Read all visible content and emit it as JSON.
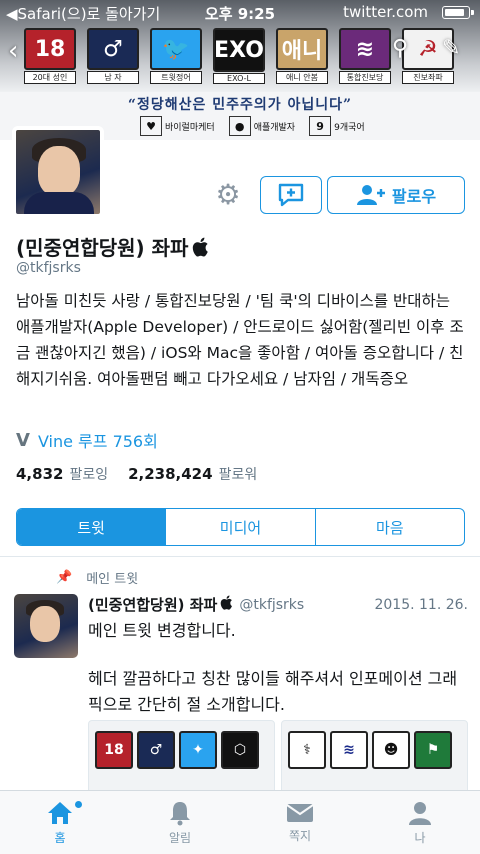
{
  "status_bar": {
    "back_app": "◀Safari(으)로 돌아가기",
    "time": "오후 9:25",
    "domain": "twitter.com",
    "battery_percent": 90
  },
  "banner": {
    "tiles": [
      {
        "label": "18",
        "caption": "20대 성인",
        "color": "#b5222b"
      },
      {
        "label": "♂",
        "caption": "남 자",
        "color": "#1a2a55"
      },
      {
        "label": "🐦",
        "caption": "트윗정어",
        "color": "#2aa3ef"
      },
      {
        "label": "EXO",
        "caption": "EXO-L",
        "color": "#111111"
      },
      {
        "label": "애니",
        "caption": "애니 안봄",
        "color": "#c9a46a"
      },
      {
        "label": "≋",
        "caption": "통합진보당",
        "color": "#6b2a7a"
      },
      {
        "label": "☭",
        "caption": "진보좌파",
        "color": "#f2f2f2"
      }
    ],
    "slogan": "“정당해산은 민주주의가 아닙니다”",
    "badges": [
      {
        "icon": "♥",
        "text": "바이럴마케터"
      },
      {
        "icon": "",
        "text": "애플개발자"
      },
      {
        "icon": "9",
        "text": "9개국어"
      }
    ]
  },
  "profile": {
    "name": "(민중연합당원) 좌파",
    "handle": "@tkfjsrks",
    "bio": "남아돌 미친듯 사랑 / 통합진보당원 / '팀 쿡'의 디바이스를 반대하는 애플개발자(Apple Developer) / 안드로이드 싫어함(젤리빈 이후 조금 괜찮아지긴 했음) / iOS와 Mac을 좋아함 / 여아돌 증오합니다 / 친해지기쉬움. 여아돌팬덤 빼고 다가오세요 / 남자임 / 개독증오",
    "vine_label": "Vine 루프 756회",
    "following_count": "4,832",
    "following_label": "팔로잉",
    "followers_count": "2,238,424",
    "followers_label": "팔로워",
    "follow_button": "팔로우"
  },
  "tabs": [
    "트윗",
    "미디어",
    "마음"
  ],
  "pinned_label": "메인 트윗",
  "tweet": {
    "name": "(민중연합당원) 좌파",
    "handle": "@tkfjsrks",
    "date": "2015. 11. 26.",
    "line1": "메인 트윗 변경합니다.",
    "line2": "헤더 깔끔하다고 칭찬 많이들 해주셔서 인포메이션 그래픽으로 간단히 절 소개합니다."
  },
  "tabbar": [
    {
      "label": "홈",
      "icon": "home-icon"
    },
    {
      "label": "알림",
      "icon": "bell-icon"
    },
    {
      "label": "쪽지",
      "icon": "envelope-icon"
    },
    {
      "label": "나",
      "icon": "person-icon"
    }
  ],
  "colors": {
    "accent": "#1b95e0",
    "muted": "#657786"
  }
}
